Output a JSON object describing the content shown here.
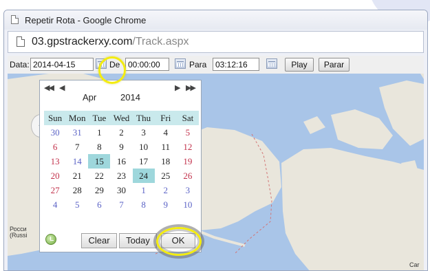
{
  "window": {
    "title": "Repetir Rota - Google Chrome"
  },
  "address": {
    "host": "03.gpstrackerxy.com",
    "path": "/Track.aspx"
  },
  "toolbar": {
    "data_label": "Data:",
    "date_value": "2014-04-15",
    "de_label": "De",
    "from_time": "00:00:00",
    "para_label": "Para",
    "to_time": "03:12:16",
    "play_label": "Play",
    "stop_label": "Parar"
  },
  "calendar": {
    "nav": {
      "prev_year": "◀◀",
      "prev_month": "◀",
      "next_month": "▶",
      "next_year": "▶▶"
    },
    "month": "Apr",
    "year": "2014",
    "weekdays": [
      "Sun",
      "Mon",
      "Tue",
      "Wed",
      "Thu",
      "Fri",
      "Sat"
    ],
    "weeks": [
      [
        "30",
        "31",
        "1",
        "2",
        "3",
        "4",
        "5"
      ],
      [
        "6",
        "7",
        "8",
        "9",
        "10",
        "11",
        "12"
      ],
      [
        "13",
        "14",
        "15",
        "16",
        "17",
        "18",
        "19"
      ],
      [
        "20",
        "21",
        "22",
        "23",
        "24",
        "25",
        "26"
      ],
      [
        "27",
        "28",
        "29",
        "30",
        "1",
        "2",
        "3"
      ],
      [
        "4",
        "5",
        "6",
        "7",
        "8",
        "9",
        "10"
      ]
    ],
    "selected_days": [
      "15",
      "24"
    ],
    "clear_label": "Clear",
    "today_label": "Today",
    "ok_label": "OK"
  },
  "map": {
    "label_russia_1": "Росси",
    "label_russia_2": "(Russi",
    "label_canada": "Car"
  },
  "colors": {
    "highlight": "#f3ec10",
    "header_cyan": "#c9e9ec",
    "selected_cyan": "#9ed7dc",
    "weekend_red": "#c2304a",
    "other_month_blue": "#5b63c6",
    "ocean": "#a9c5e8",
    "land": "#e9e6dc"
  }
}
